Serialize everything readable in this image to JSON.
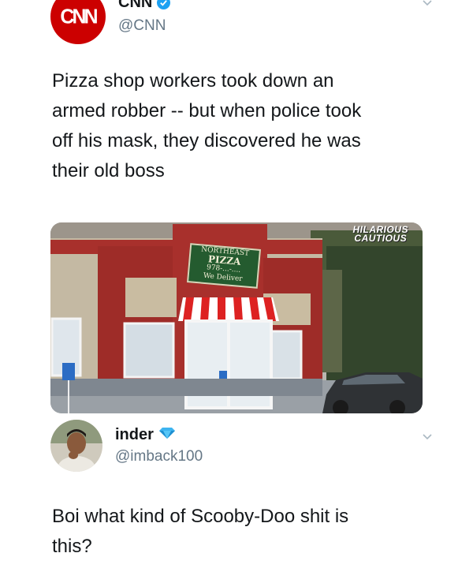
{
  "tweet1": {
    "display_name": "CNN",
    "handle": "@CNN",
    "logo_text": "CNN",
    "verified_icon": "verified-check-icon",
    "text": "Pizza shop workers took down an armed robber -- but when police took off his mask, they discovered he was their old boss",
    "text_lines": [
      "Pizza shop workers took down an",
      "armed robber -- but when police took",
      "off his mask, they discovered he was",
      "their old boss"
    ],
    "photo": {
      "watermark_line1": "HILARIOUS",
      "watermark_line2": "CAUTIOUS",
      "sign_line1": "NORTHEAST",
      "sign_line2": "PIZZA",
      "sign_line3": "978-...-....",
      "sign_line4": "We Deliver"
    }
  },
  "tweet2": {
    "display_name": "inder",
    "handle": "@imback100",
    "badge_icon": "diamond-icon",
    "text_lines": [
      "Boi what kind of Scooby-Doo shit is",
      "this?"
    ]
  },
  "colors": {
    "cnn_red": "#cc0000",
    "verified_blue": "#1da1f2",
    "handle_gray": "#657786",
    "text_dark": "#14171a"
  }
}
